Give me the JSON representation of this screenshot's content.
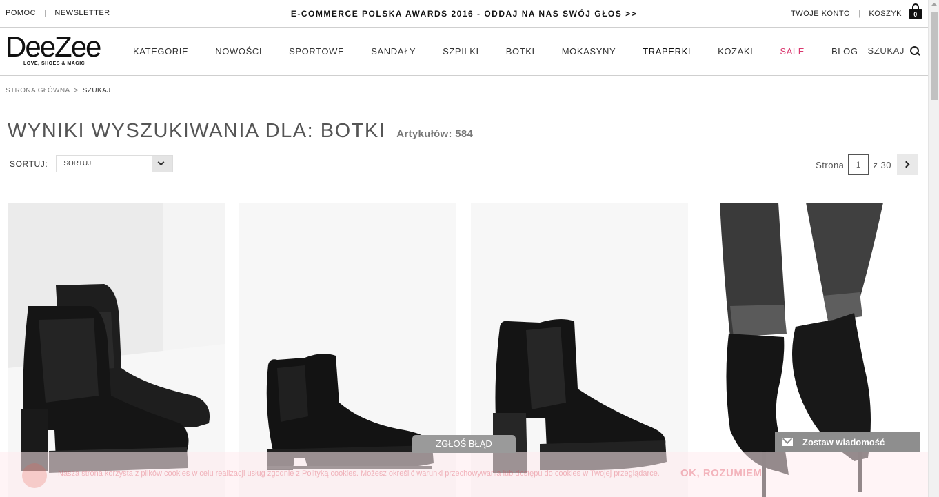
{
  "topbar": {
    "help": "POMOC",
    "newsletter": "NEWSLETTER",
    "promo": "E-COMMERCE POLSKA AWARDS 2016 - ODDAJ NA NAS SWÓJ GŁOS >>",
    "account": "TWOJE KONTO",
    "cart": "KOSZYK",
    "cart_count": "0"
  },
  "logo": {
    "brand": "DeeZee",
    "tagline": "LOVE, SHOES & MAGIC"
  },
  "nav": {
    "items": [
      "KATEGORIE",
      "NOWOŚCI",
      "SPORTOWE",
      "SANDAŁY",
      "SZPILKI",
      "BOTKI",
      "MOKASYNY",
      "TRAPERKI",
      "KOZAKI",
      "SALE",
      "BLOG"
    ],
    "search_label": "SZUKAJ",
    "sale_color": "#d9376e"
  },
  "breadcrumb": {
    "home": "STRONA GŁÓWNA",
    "sep": ">",
    "current": "SZUKAJ"
  },
  "heading": {
    "title": "WYNIKI WYSZUKIWANIA DLA: BOTKI",
    "count": "Artykułów: 584"
  },
  "sort": {
    "label": "SORTUJ:",
    "value": "SORTUJ"
  },
  "pager": {
    "label": "Strona",
    "page": "1",
    "of": "z 30"
  },
  "cookie": {
    "text": "Nasza strona korzysta z plików cookies w celu realizacji usług zgodnie z Polityką cookies. Możesz określić warunki przechowywania lub dostępu do cookies w Twojej przeglądarce.",
    "ok": "OK, ROZUMIEM"
  },
  "report_button": "ZGŁOŚ BŁĄD",
  "message_button": "Zostaw wiadomość"
}
